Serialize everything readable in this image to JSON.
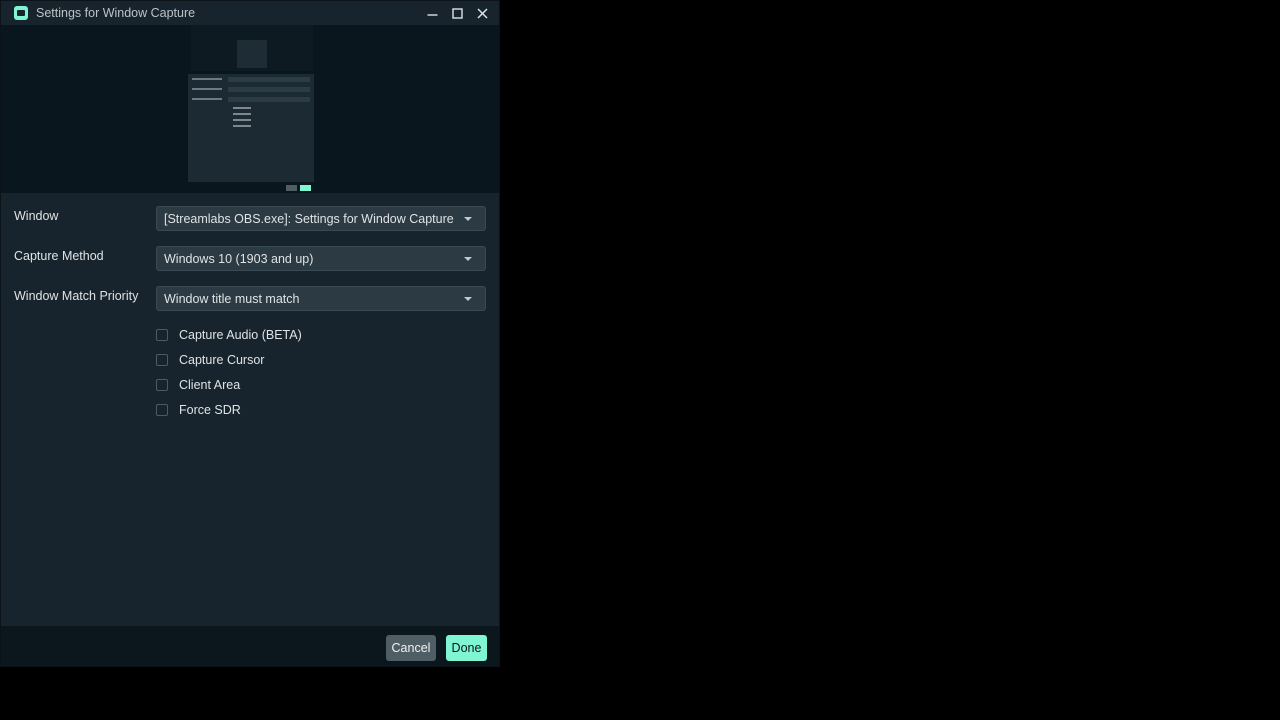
{
  "window": {
    "title": "Settings for Window Capture"
  },
  "form": {
    "fields": [
      {
        "label": "Window",
        "value": "[Streamlabs OBS.exe]: Settings for Window Capture"
      },
      {
        "label": "Capture Method",
        "value": "Windows 10 (1903 and up)"
      },
      {
        "label": "Window Match Priority",
        "value": "Window title must match"
      }
    ],
    "checkboxes": [
      {
        "label": "Capture Audio (BETA)",
        "checked": false
      },
      {
        "label": "Capture Cursor",
        "checked": false
      },
      {
        "label": "Client Area",
        "checked": false
      },
      {
        "label": "Force SDR",
        "checked": false
      }
    ]
  },
  "footer": {
    "cancel_label": "Cancel",
    "done_label": "Done"
  },
  "colors": {
    "accent": "#80f5d2",
    "background": "#17242d",
    "footer": "#0b161d"
  },
  "icons": {
    "app": "streamlabs-icon",
    "minimize": "minimize-icon",
    "maximize": "maximize-icon",
    "close": "close-icon",
    "dropdown": "chevron-down-icon"
  }
}
